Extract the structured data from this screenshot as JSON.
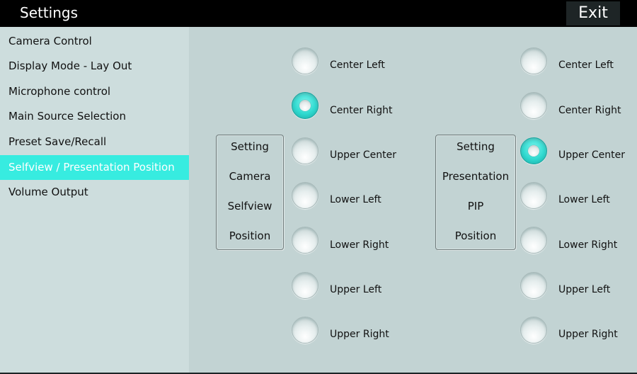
{
  "header": {
    "title": "Settings",
    "exit_label": "Exit"
  },
  "sidebar": {
    "items": [
      {
        "label": "Camera Control",
        "active": false
      },
      {
        "label": "Display Mode - Lay Out",
        "active": false
      },
      {
        "label": "Microphone control",
        "active": false
      },
      {
        "label": "Main Source Selection",
        "active": false
      },
      {
        "label": "Preset Save/Recall",
        "active": false
      },
      {
        "label": "Selfview / Presentation Position",
        "active": true
      },
      {
        "label": "Volume Output",
        "active": false
      }
    ]
  },
  "selfview_group": {
    "lines": [
      "Setting",
      "Camera",
      "Selfview",
      "Position"
    ],
    "options": [
      {
        "label": "Center Left",
        "selected": false
      },
      {
        "label": "Center Right",
        "selected": true
      },
      {
        "label": "Upper Center",
        "selected": false
      },
      {
        "label": "Lower Left",
        "selected": false
      },
      {
        "label": "Lower Right",
        "selected": false
      },
      {
        "label": "Upper Left",
        "selected": false
      },
      {
        "label": "Upper Right",
        "selected": false
      }
    ]
  },
  "presentation_group": {
    "lines": [
      "Setting",
      "Presentation",
      "PIP",
      "Position"
    ],
    "options": [
      {
        "label": "Center Left",
        "selected": false
      },
      {
        "label": "Center Right",
        "selected": false
      },
      {
        "label": "Upper Center",
        "selected": true
      },
      {
        "label": "Lower Left",
        "selected": false
      },
      {
        "label": "Lower Right",
        "selected": false
      },
      {
        "label": "Upper Left",
        "selected": false
      },
      {
        "label": "Upper Right",
        "selected": false
      }
    ]
  },
  "colors": {
    "accent": "#37ece0",
    "titlebar": "#000000",
    "sidebar_bg": "#cddddd",
    "main_bg": "#c2d3d3"
  }
}
